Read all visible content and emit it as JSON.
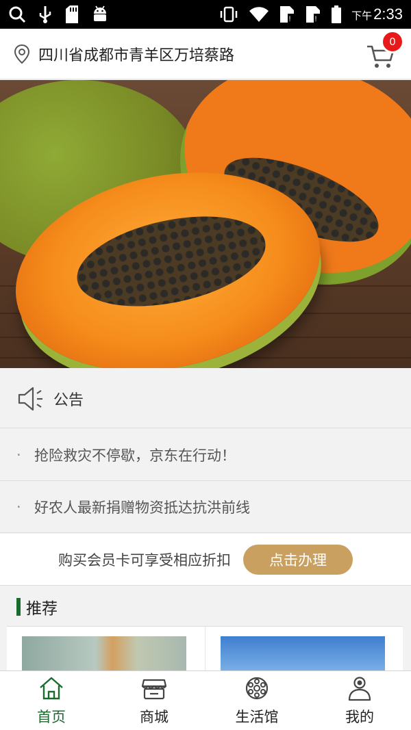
{
  "status_bar": {
    "time_prefix": "下午",
    "time": "2:33",
    "left_icons": [
      "search-icon",
      "usb-icon",
      "sd-card-icon",
      "android-icon"
    ],
    "right_icons": [
      "vibrate-icon",
      "wifi-icon",
      "sim1-icon",
      "sim2-icon",
      "battery-icon"
    ]
  },
  "header": {
    "address": "四川省成都市青羊区万培蔡路",
    "cart_count": "0"
  },
  "banner": {
    "slide_count": 4,
    "active_slide": 4
  },
  "notice": {
    "title": "公告",
    "bullet": "·",
    "items": [
      "抢险救灾不停歇，京东在行动！",
      "好农人最新捐赠物资抵达抗洪前线"
    ]
  },
  "member": {
    "text": "购买会员卡可享受相应折扣",
    "button": "点击办理"
  },
  "recommend": {
    "title": "推荐"
  },
  "tabbar": {
    "items": [
      {
        "label": "首页",
        "icon": "home-icon",
        "active": true
      },
      {
        "label": "商城",
        "icon": "store-icon",
        "active": false
      },
      {
        "label": "生活馆",
        "icon": "lifestyle-icon",
        "active": false
      },
      {
        "label": "我的",
        "icon": "user-icon",
        "active": false
      }
    ]
  },
  "colors": {
    "accent_green": "#1a6b2e",
    "member_button": "#c9a060",
    "badge_red": "#e8191b"
  }
}
